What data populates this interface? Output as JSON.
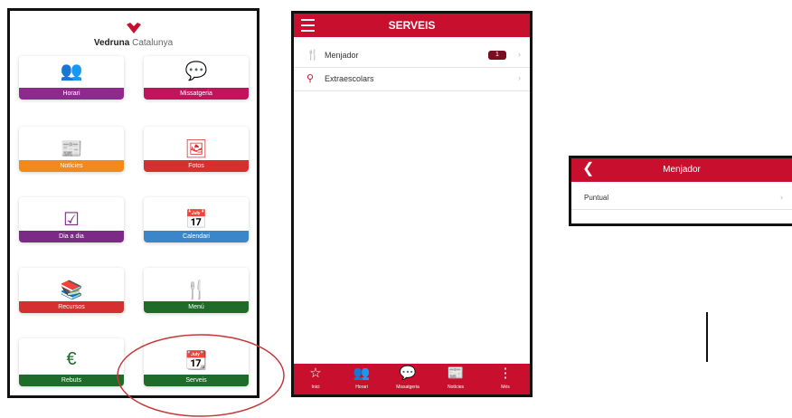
{
  "home": {
    "logo": {
      "bold": "Vedruna",
      "light": " Catalunya"
    },
    "tiles": [
      {
        "label": "Horari",
        "icon": "people-icon",
        "glyph": "👥",
        "bar": "#8e2a8c",
        "icon_color": "#9b3a9a"
      },
      {
        "label": "Missatgeria",
        "icon": "chat-icon",
        "glyph": "💬",
        "bar": "#c4135d",
        "icon_color": "#c4135d"
      },
      {
        "label": "Notícies",
        "icon": "newspaper-icon",
        "glyph": "📰",
        "bar": "#f08a1c",
        "icon_color": "#f08a1c"
      },
      {
        "label": "Fotos",
        "icon": "photo-icon",
        "glyph": "🖼",
        "bar": "#d62f2f",
        "icon_color": "#d62f2f"
      },
      {
        "label": "Dia a dia",
        "icon": "checklist-icon",
        "glyph": "☑",
        "bar": "#7b2a86",
        "icon_color": "#7b2a86"
      },
      {
        "label": "Calendari",
        "icon": "calendar-icon",
        "glyph": "📅",
        "bar": "#3a86c8",
        "icon_color": "#3a86c8"
      },
      {
        "label": "Recursos",
        "icon": "books-icon",
        "glyph": "📚",
        "bar": "#d62f2f",
        "icon_color": "#d62f2f"
      },
      {
        "label": "Menú",
        "icon": "fork-knife-icon",
        "glyph": "🍴",
        "bar": "#1e6b2a",
        "icon_color": "#1e6b2a"
      },
      {
        "label": "Rebuts",
        "icon": "euro-icon",
        "glyph": "€",
        "bar": "#1e6b2a",
        "icon_color": "#1e6b2a"
      },
      {
        "label": "Serveis",
        "icon": "calendar-plus-icon",
        "glyph": "📆",
        "bar": "#1e6b2a",
        "icon_color": "#1e6b2a"
      }
    ]
  },
  "serveis": {
    "title": "SERVEIS",
    "rows": [
      {
        "label": "Menjador",
        "icon": "fork-knife-icon",
        "glyph": "🍴",
        "badge": "1"
      },
      {
        "label": "Extraescolars",
        "icon": "pin-icon",
        "glyph": "⚲",
        "badge": ""
      }
    ],
    "tabs": [
      {
        "label": "Inici",
        "icon": "star-icon",
        "glyph": "☆"
      },
      {
        "label": "Horari",
        "icon": "people-icon",
        "glyph": "👥"
      },
      {
        "label": "Missatgeria",
        "icon": "chat-icon",
        "glyph": "💬"
      },
      {
        "label": "Notícies",
        "icon": "newspaper-icon",
        "glyph": "📰"
      },
      {
        "label": "Més",
        "icon": "more-vertical-icon",
        "glyph": "⋮"
      }
    ]
  },
  "menjador": {
    "title": "Menjador",
    "rows": [
      {
        "label": "Puntual"
      }
    ]
  },
  "colors": {
    "brand_red": "#c8102e",
    "annotation_circle": "#c23a3a"
  }
}
